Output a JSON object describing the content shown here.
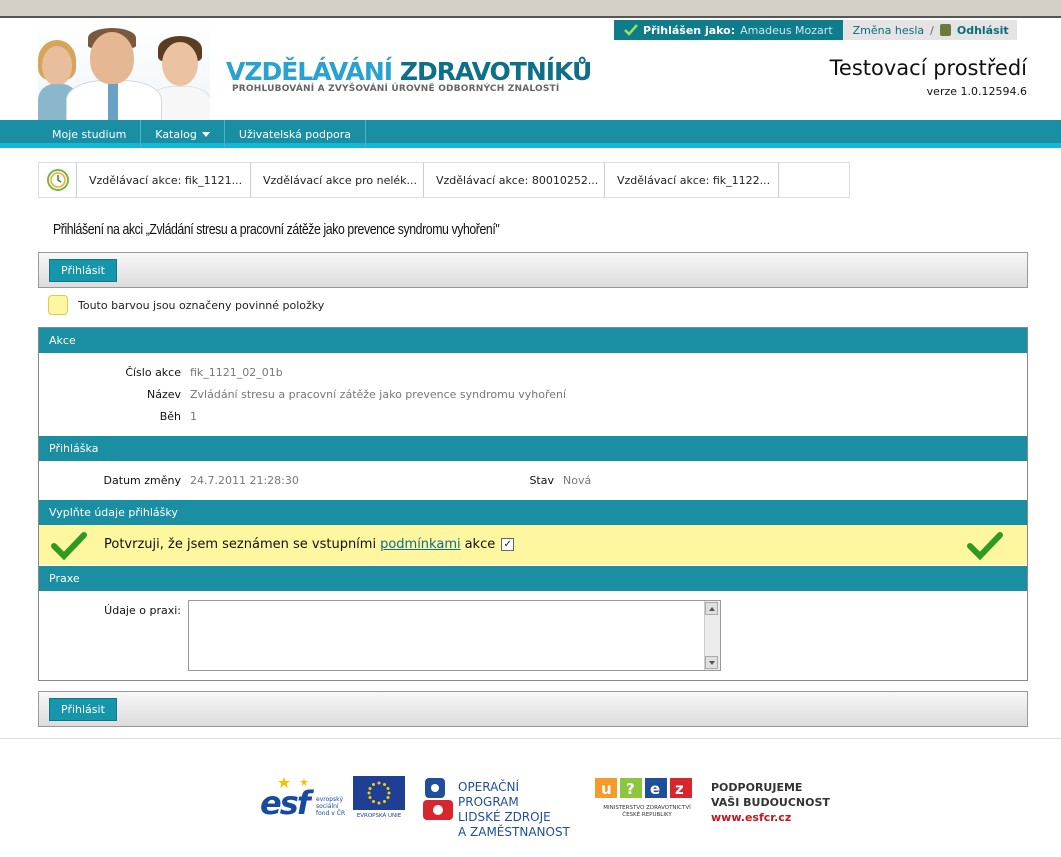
{
  "header": {
    "brand_part1": "VZDĚLÁVÁNÍ ",
    "brand_part2": "ZDRAVOTNÍKŮ",
    "brand_sub": "PROHLUBOVÁNÍ A ZVYŠOVÁNÍ ÚROVNĚ ODBORNÝCH ZNALOSTÍ",
    "logged_label": "Přihlášen jako:",
    "user": "Amadeus Mozart",
    "change_password": "Změna hesla",
    "separator": "/",
    "logout": "Odhlásit",
    "env_title": "Testovací prostředí",
    "version": "verze 1.0.12594.6"
  },
  "nav": {
    "items": [
      "Moje studium",
      "Katalog",
      "Uživatelská podpora"
    ]
  },
  "breadcrumb": {
    "items": [
      "Vzdělávací akce: fik_1121...",
      "Vzdělávací akce pro nelék...",
      "Vzdělávací akce: 80010252...",
      "Vzdělávací akce: fik_1122..."
    ]
  },
  "page": {
    "title": "Přihlášení na akci „Zvládání stresu a pracovní zátěže jako prevence syndromu vyhoření\"",
    "submit_label": "Přihlásit",
    "legend": "Touto barvou jsou označeny povinné položky"
  },
  "sections": {
    "akce": {
      "title": "Akce",
      "cislo_label": "Číslo akce",
      "cislo_value": "fik_1121_02_01b",
      "nazev_label": "Název",
      "nazev_value": "Zvládání stresu a pracovní zátěže jako prevence syndromu vyhoření",
      "beh_label": "Běh",
      "beh_value": "1"
    },
    "prihlaska": {
      "title": "Přihláška",
      "datum_label": "Datum změny",
      "datum_value": "24.7.2011 21:28:30",
      "stav_label": "Stav",
      "stav_value": "Nová"
    },
    "vyplnte": {
      "title": "Vyplňte údaje přihlášky",
      "confirm_pre": "Potvrzuji, že jsem seznámen se vstupními",
      "confirm_link": "podmínkami",
      "confirm_post": "akce",
      "checked": true
    },
    "praxe": {
      "title": "Praxe",
      "udaje_label": "Údaje o praxi:",
      "udaje_value": ""
    }
  },
  "footer": {
    "esf_logo": "esf",
    "esf_small": "evropský sociální fond v ČR",
    "eu_label": "EVROPSKÁ UNIE",
    "op_line1": "OPERAČNÍ PROGRAM",
    "op_line2": "LIDSKÉ ZDROJE",
    "op_line3": "A ZAMĚSTNANOST",
    "mz_line1": "MINISTERSTVO ZDRAVOTNICTVÍ",
    "mz_line2": "ČESKÉ REPUBLIKY",
    "pv_line1": "PODPORUJEME",
    "pv_line2": "VAŠI BUDOUCNOST",
    "pv_url": "www.esfcr.cz"
  },
  "colors": {
    "teal": "#1a8ea2",
    "required_yellow": "#fff6a0",
    "brand_blue": "#2aa2d1"
  }
}
